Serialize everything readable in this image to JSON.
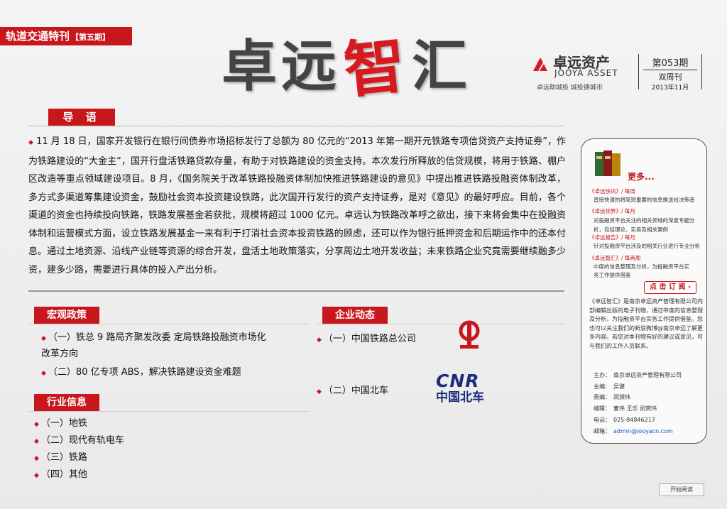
{
  "header": {
    "special_title": "轨道交通特刊",
    "special_issue": "【第五期】",
    "brand_part1": "卓远",
    "brand_part2": "智",
    "brand_part3": "汇",
    "company_cn": "卓远资产",
    "company_en": "JOOYA ASSET",
    "slogan": "卓远助城投  城投铸城市",
    "issue_no": "第053期",
    "frequency": "双周刊",
    "issue_date": "2013年11月"
  },
  "intro": {
    "label": "导 语",
    "text": "11 月 18 日，国家开发银行在银行间债券市场招标发行了总额为 80 亿元的“2013 年第一期开元铁路专项信贷资产支持证券”，作为铁路建设的“大金主”，国开行盘活铁路贷款存量，有助于对铁路建设的资金支持。本次发行所释放的信贷规模，将用于铁路、棚户区改造等重点领域建设项目。8 月，《国务院关于改革铁路投融资体制加快推进铁路建设的意见》中提出推进铁路投融资体制改革，多方式多渠道筹集建设资金，鼓励社会资本投资建设铁路，此次国开行发行的资产支持证券，是对《意见》的最好呼应。目前，各个渠道的资金也持续投向铁路，铁路发展基金若获批，规模将超过 1000 亿元。卓远认为铁路改革呼之欲出，接下来将会集中在投融资体制和运营模式方面，设立铁路发展基金一来有利于打消社会资本投资铁路的顾虑，还可以作为银行抵押资金和后期运作中的还本付息。通过土地资源、沿线产业链等资源的综合开发，盘活土地政策落实，分享周边土地开发收益；未来铁路企业究竟需要继续融多少资，建多少路，需要进行具体的投入产出分析。"
  },
  "macro": {
    "label": "宏观政策",
    "items": [
      "（一）铁总 9 路局齐聚发改委 定局铁路投融资市场化改革方向",
      "（二）80 亿专项 ABS，解决铁路建设资金难题"
    ]
  },
  "industry": {
    "label": "行业信息",
    "items": [
      "（一）地铁",
      "（二）现代有轨电车",
      "（三）铁路",
      "（四）其他"
    ]
  },
  "corporate": {
    "label": "企业动态",
    "items": [
      "（一）中国铁路总公司",
      "（二）中国北车"
    ],
    "cnr_logo_text": "CNR",
    "cnr_logo_cn": "中国北车"
  },
  "panel": {
    "more": "更多...",
    "entries": [
      {
        "head": "《卓远快讯》/ 每周",
        "desc": [
          "直接快速的将简短重要的信息推送给决策者"
        ]
      },
      {
        "head": "《卓远视界》/ 每月",
        "desc": [
          "对投融资平台关注的相关领域的深度专题分",
          "析，包括理论、实务及相关案例"
        ]
      },
      {
        "head": "《卓远报告》/ 每月",
        "desc": [
          "针对投融资平台涉及的相关行业进行专业分析"
        ]
      },
      {
        "head": "《卓远智汇》/ 每两周",
        "desc": [
          "中度的信息整理及分析，为投融资平台实",
          "务工作提供借鉴"
        ]
      }
    ],
    "subscribe": "点 击 订 阅",
    "description": "《卓远智汇》是南京卓远资产管理有限公司内部编辑出版的电子刊物，通过中度的信息整理及分析，为投融资平台实务工作提供借鉴。您也可以关注我们的新浪微博@南京卓远了解更多内容。若您对本刊物有好的建议或意见，可与我们的工作人员联系。",
    "credits": [
      {
        "k": "主办：",
        "v": "南京卓远资产管理有限公司"
      },
      {
        "k": "主编：",
        "v": "吴健"
      },
      {
        "k": "责编：",
        "v": "闵赟炜"
      },
      {
        "k": "编辑：",
        "v": "曹伟  王乐  闵赟炜"
      },
      {
        "k": "电话：",
        "v": "025-84846217"
      },
      {
        "k": "邮箱：",
        "v": "admin@jooyacn.com"
      }
    ],
    "start_reading": "开始阅读"
  },
  "colors": {
    "accent": "#c8161d",
    "text": "#222222",
    "link": "#1a56c8"
  }
}
